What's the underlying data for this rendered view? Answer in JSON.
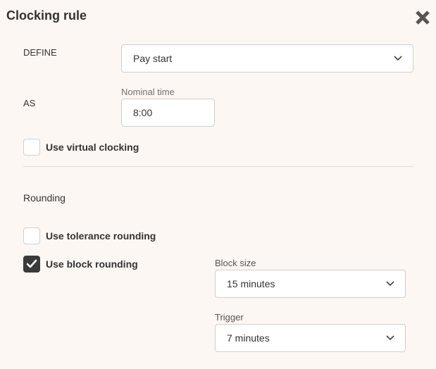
{
  "dialog": {
    "title": "Clocking rule",
    "close_icon": "close-x-icon"
  },
  "define": {
    "label": "DEFINE",
    "selected": "Pay start"
  },
  "as": {
    "label": "AS",
    "nominal_time_label": "Nominal time",
    "nominal_time_value": "8:00"
  },
  "virtual_clocking": {
    "label": "Use virtual clocking",
    "checked": false
  },
  "rounding": {
    "heading": "Rounding",
    "tolerance": {
      "label": "Use tolerance rounding",
      "checked": false
    },
    "block": {
      "label": "Use block rounding",
      "checked": true
    },
    "block_size": {
      "label": "Block size",
      "selected": "15 minutes"
    },
    "trigger": {
      "label": "Trigger",
      "selected": "7 minutes"
    }
  },
  "colors": {
    "background": "#fdf7f3",
    "checked_box": "#3a3a3a",
    "border": "#d0cfcf"
  }
}
